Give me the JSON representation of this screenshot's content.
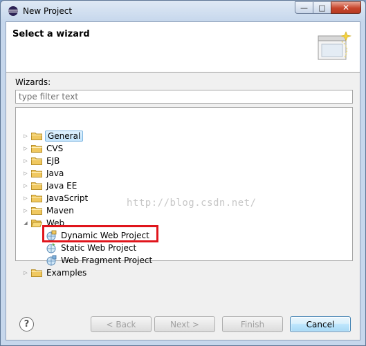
{
  "window": {
    "title": "New Project",
    "controls": {
      "minimize": "—",
      "maximize": "□",
      "close": "✕"
    }
  },
  "header": {
    "title": "Select a wizard"
  },
  "wizards": {
    "label": "Wizards:",
    "filter_placeholder": "type filter text",
    "tree": [
      {
        "label": "General",
        "expanded": false,
        "selected": true
      },
      {
        "label": "CVS",
        "expanded": false
      },
      {
        "label": "EJB",
        "expanded": false
      },
      {
        "label": "Java",
        "expanded": false
      },
      {
        "label": "Java EE",
        "expanded": false
      },
      {
        "label": "JavaScript",
        "expanded": false
      },
      {
        "label": "Maven",
        "expanded": false
      },
      {
        "label": "Web",
        "expanded": true
      },
      {
        "label": "Dynamic Web Project",
        "child": true,
        "highlighted": true
      },
      {
        "label": "Static Web Project",
        "child": true
      },
      {
        "label": "Web Fragment Project",
        "child": true
      },
      {
        "label": "Examples",
        "expanded": false
      }
    ]
  },
  "watermark": "http://blog.csdn.net/",
  "buttons": {
    "help": "?",
    "back": "< Back",
    "next": "Next >",
    "finish": "Finish",
    "cancel": "Cancel"
  },
  "colors": {
    "highlight_border": "#e0151c",
    "folder_fill": "#f0c860",
    "selection": "#c3e4fb"
  }
}
